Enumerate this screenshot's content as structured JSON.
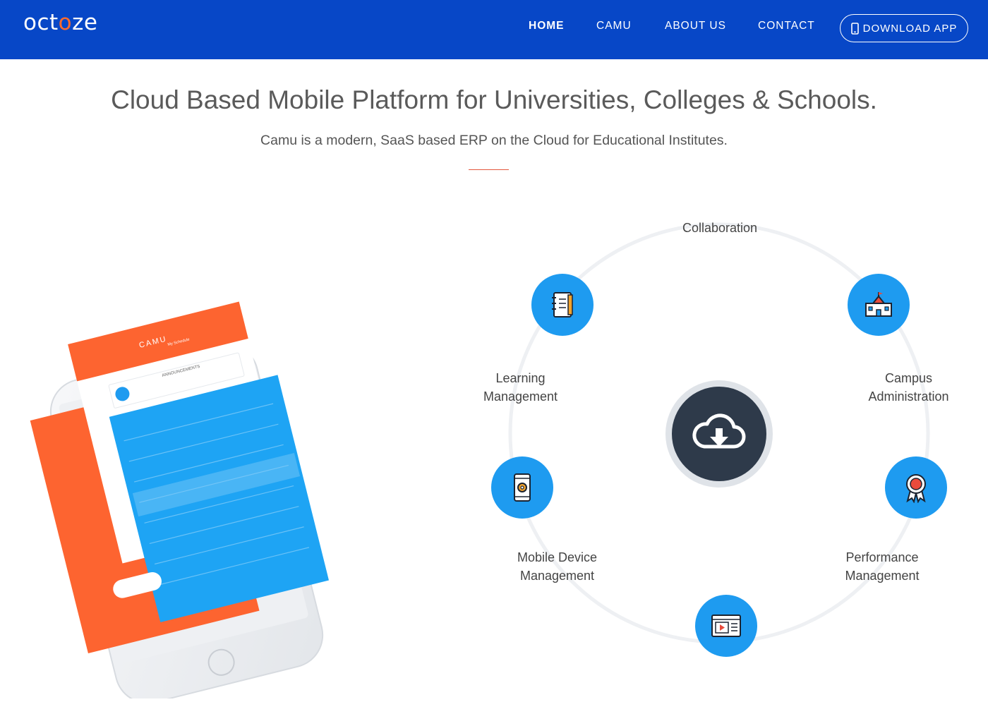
{
  "brand": {
    "logo_prefix": "oct",
    "logo_accent": "o",
    "logo_suffix": "ze"
  },
  "nav": {
    "items": [
      {
        "label": "HOME",
        "active": true
      },
      {
        "label": "CAMU",
        "active": false
      },
      {
        "label": "ABOUT US",
        "active": false
      },
      {
        "label": "CONTACT",
        "active": false
      }
    ],
    "download_label": "DOWNLOAD APP"
  },
  "hero": {
    "title": "Cloud Based Mobile Platform for Universities, Colleges & Schools.",
    "subtitle": "Camu is a modern, SaaS based ERP on the Cloud for Educational Institutes."
  },
  "phone": {
    "app_name": "CAMU",
    "tab_active": "My Schedule",
    "announcement_title": "ANNOUNCEMENTS"
  },
  "features": [
    {
      "label": "Collaboration",
      "icon": "notebook-icon"
    },
    {
      "label_line1": "Learning",
      "label_line2": "Management",
      "icon": "notebook-icon"
    },
    {
      "label_line1": "Campus",
      "label_line2": "Administration",
      "icon": "school-building-icon"
    },
    {
      "label_line1": "Mobile Device",
      "label_line2": "Management",
      "icon": "mobile-gear-icon"
    },
    {
      "label_line1": "Performance",
      "label_line2": "Management",
      "icon": "award-ribbon-icon"
    },
    {
      "icon": "video-player-icon"
    }
  ],
  "hub": {
    "icon": "cloud-download-icon"
  },
  "colors": {
    "nav_bg": "#0747c7",
    "accent": "#1e9bf0",
    "orange": "#fd6430",
    "hub": "#2e3a4a"
  }
}
